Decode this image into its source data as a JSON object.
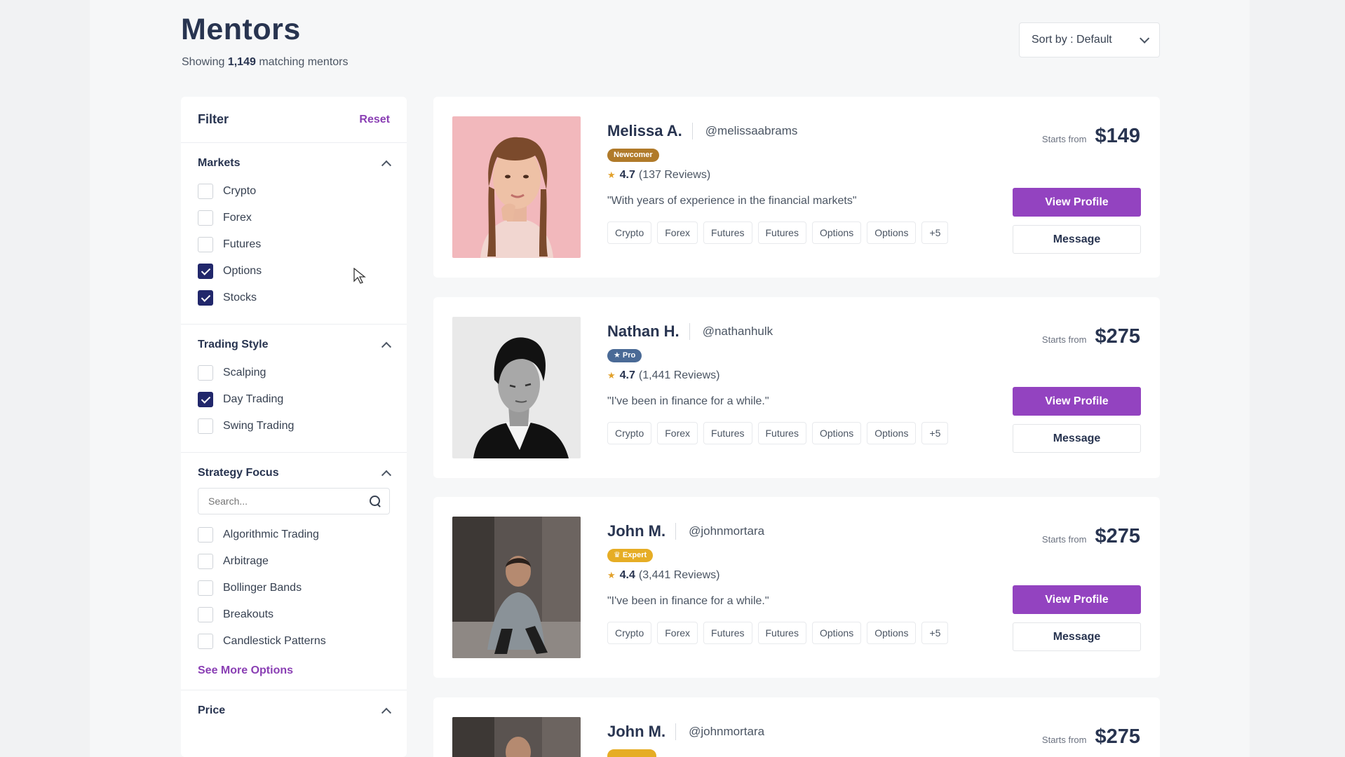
{
  "header": {
    "title": "Mentors",
    "subtitle_prefix": "Showing",
    "count": "1,149",
    "subtitle_suffix": "matching mentors"
  },
  "sort": {
    "label": "Sort by : Default",
    "icon": "chevron-down-icon"
  },
  "filter": {
    "title": "Filter",
    "reset_label": "Reset",
    "markets": {
      "title": "Markets",
      "options": [
        {
          "label": "Crypto",
          "checked": false
        },
        {
          "label": "Forex",
          "checked": false
        },
        {
          "label": "Futures",
          "checked": false
        },
        {
          "label": "Options",
          "checked": true
        },
        {
          "label": "Stocks",
          "checked": true
        }
      ]
    },
    "trading_style": {
      "title": "Trading Style",
      "options": [
        {
          "label": "Scalping",
          "checked": false
        },
        {
          "label": "Day Trading",
          "checked": true
        },
        {
          "label": "Swing Trading",
          "checked": false
        }
      ]
    },
    "strategy_focus": {
      "title": "Strategy Focus",
      "search_placeholder": "Search...",
      "options": [
        {
          "label": "Algorithmic Trading",
          "checked": false
        },
        {
          "label": "Arbitrage",
          "checked": false
        },
        {
          "label": "Bollinger Bands",
          "checked": false
        },
        {
          "label": "Breakouts",
          "checked": false
        },
        {
          "label": "Candlestick Patterns",
          "checked": false
        }
      ],
      "see_more_label": "See More Options"
    },
    "price": {
      "title": "Price"
    }
  },
  "mentors": [
    {
      "name": "Melissa A.",
      "handle": "@melissaabrams",
      "badge": "Newcomer",
      "badge_color": "#b07a2a",
      "rating": "4.7",
      "reviews": "(137 Reviews)",
      "quote": "\"With years of experience in the financial markets\"",
      "tags": [
        "Crypto",
        "Forex",
        "Futures",
        "Futures",
        "Options",
        "Options",
        "+5"
      ],
      "starts_from": "Starts from",
      "price": "$149",
      "view_label": "View Profile",
      "message_label": "Message"
    },
    {
      "name": "Nathan H.",
      "handle": "@nathanhulk",
      "badge": "★ Pro",
      "badge_color": "#4a6a96",
      "rating": "4.7",
      "reviews": "(1,441 Reviews)",
      "quote": "\"I've been in finance for a while.\"",
      "tags": [
        "Crypto",
        "Forex",
        "Futures",
        "Futures",
        "Options",
        "Options",
        "+5"
      ],
      "starts_from": "Starts from",
      "price": "$275",
      "view_label": "View Profile",
      "message_label": "Message"
    },
    {
      "name": "John M.",
      "handle": "@johnmortara",
      "badge": "♛ Expert",
      "badge_color": "#e6ad25",
      "rating": "4.4",
      "reviews": "(3,441 Reviews)",
      "quote": "\"I've been in finance for a while.\"",
      "tags": [
        "Crypto",
        "Forex",
        "Futures",
        "Futures",
        "Options",
        "Options",
        "+5"
      ],
      "starts_from": "Starts from",
      "price": "$275",
      "view_label": "View Profile",
      "message_label": "Message"
    },
    {
      "name": "John M.",
      "handle": "@johnmortara",
      "badge_color": "#e6ad25",
      "starts_from": "Starts from",
      "price": "$275"
    }
  ],
  "colors": {
    "accent": "#9343c0",
    "checkbox": "#21276b",
    "title": "#283450",
    "star": "#e2a12b"
  }
}
